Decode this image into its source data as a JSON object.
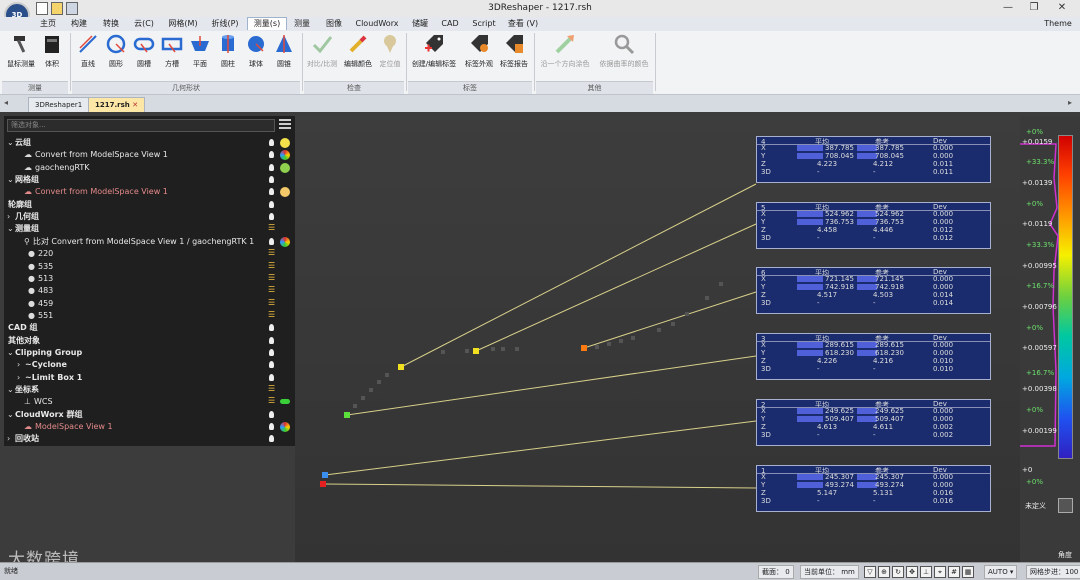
{
  "app": {
    "title": "3DReshaper - 1217.rsh",
    "icon_text": "3D"
  },
  "menu": [
    "主页",
    "构建",
    "转换",
    "云(C)",
    "网格(M)",
    "折线(P)",
    "测量(s)",
    "测量",
    "图像",
    "CloudWorx",
    "储罐",
    "CAD",
    "Script",
    "查看 (V)"
  ],
  "menu_active": "测量(s)",
  "theme_label": "Theme",
  "ribbon": {
    "buttons": [
      {
        "label": "鼠标测量",
        "icon": "hammer-icon"
      },
      {
        "label": "体积",
        "icon": "bucket-icon"
      },
      {
        "label": "直线",
        "icon": "line-icon"
      },
      {
        "label": "圆形",
        "icon": "circle-icon"
      },
      {
        "label": "圆槽",
        "icon": "slot-icon"
      },
      {
        "label": "方槽",
        "icon": "rect-slot-icon"
      },
      {
        "label": "平面",
        "icon": "plane-icon"
      },
      {
        "label": "圆柱",
        "icon": "cylinder-icon"
      },
      {
        "label": "球体",
        "icon": "sphere-icon"
      },
      {
        "label": "圆锥",
        "icon": "cone-icon"
      },
      {
        "label": "对比/比测",
        "icon": "check-icon"
      },
      {
        "label": "编辑颜色",
        "icon": "color-pencil-icon"
      },
      {
        "label": "定位值",
        "icon": "pin-icon"
      },
      {
        "label": "创建/编辑标签",
        "icon": "tag-icon"
      },
      {
        "label": "标签外观",
        "icon": "tag-style-icon"
      },
      {
        "label": "标签报告",
        "icon": "tag-report-icon"
      },
      {
        "label": "沿一个方向涂色",
        "icon": "direction-color-icon"
      },
      {
        "label": "依据曲率的颜色",
        "icon": "magnifier-icon"
      }
    ],
    "groups": [
      "测量",
      "几何形状",
      "检查",
      "标签",
      "其他"
    ]
  },
  "tabs": [
    "3DReshaper1",
    "1217.rsh"
  ],
  "tree": {
    "filter_placeholder": "筛选对象...",
    "items": [
      "云组",
      "Convert from ModelSpace  View 1",
      "gaochengRTK",
      "网格组",
      "Convert from ModelSpace  View 1",
      "轮廓组",
      "几何组",
      "测量组",
      "比对 Convert from ModelSpace  View 1 / gaochengRTK 1",
      "220",
      "535",
      "513",
      "483",
      "459",
      "551",
      "CAD 组",
      "其他对象",
      "Clipping Group",
      "~Cyclone",
      "~Limit Box 1",
      "坐标系",
      "WCS",
      "CloudWorx 群组",
      "ModelSpace  View 1",
      "回收站"
    ]
  },
  "cards": [
    {
      "id": "4",
      "hdr": [
        "平均",
        "参考",
        "Dev"
      ],
      "rows": [
        [
          "X",
          "387.785",
          "387.785",
          "0.000"
        ],
        [
          "Y",
          "708.045",
          "708.045",
          "0.000"
        ],
        [
          "Z",
          "4.223",
          "4.212",
          "0.011"
        ],
        [
          "3D",
          "-",
          "-",
          "0.011"
        ]
      ]
    },
    {
      "id": "5",
      "hdr": [
        "平均",
        "参考",
        "Dev"
      ],
      "rows": [
        [
          "X",
          "524.962",
          "524.962",
          "0.000"
        ],
        [
          "Y",
          "736.753",
          "736.753",
          "0.000"
        ],
        [
          "Z",
          "4.458",
          "4.446",
          "0.012"
        ],
        [
          "3D",
          "-",
          "-",
          "0.012"
        ]
      ]
    },
    {
      "id": "6",
      "hdr": [
        "平均",
        "参考",
        "Dev"
      ],
      "rows": [
        [
          "X",
          "721.145",
          "721.145",
          "0.000"
        ],
        [
          "Y",
          "742.918",
          "742.918",
          "0.000"
        ],
        [
          "Z",
          "4.517",
          "4.503",
          "0.014"
        ],
        [
          "3D",
          "-",
          "-",
          "0.014"
        ]
      ]
    },
    {
      "id": "3",
      "hdr": [
        "平均",
        "参考",
        "Dev"
      ],
      "rows": [
        [
          "X",
          "289.615",
          "289.615",
          "0.000"
        ],
        [
          "Y",
          "618.230",
          "618.230",
          "0.000"
        ],
        [
          "Z",
          "4.226",
          "4.216",
          "0.010"
        ],
        [
          "3D",
          "-",
          "-",
          "0.010"
        ]
      ]
    },
    {
      "id": "2",
      "hdr": [
        "平均",
        "参考",
        "Dev"
      ],
      "rows": [
        [
          "X",
          "249.625",
          "249.625",
          "0.000"
        ],
        [
          "Y",
          "509.407",
          "509.407",
          "0.000"
        ],
        [
          "Z",
          "4.613",
          "4.611",
          "0.002"
        ],
        [
          "3D",
          "-",
          "-",
          "0.002"
        ]
      ]
    },
    {
      "id": "1",
      "hdr": [
        "平均",
        "参考",
        "Dev"
      ],
      "rows": [
        [
          "X",
          "245.307",
          "245.307",
          "0.000"
        ],
        [
          "Y",
          "493.274",
          "493.274",
          "0.000"
        ],
        [
          "Z",
          "5.147",
          "5.131",
          "0.016"
        ],
        [
          "3D",
          "-",
          "-",
          "0.016"
        ]
      ]
    }
  ],
  "legend": {
    "values": [
      "+0.0159",
      "+0.0139",
      "+0.0119",
      "+0.00995",
      "+0.00796",
      "+0.00597",
      "+0.00398",
      "+0.00199",
      "+0"
    ],
    "percents": [
      "+0%",
      "+33.3%",
      "+0%",
      "+33.3%",
      "+16.7%",
      "+0%",
      "+16.7%",
      "+0%",
      "+0%"
    ],
    "undefined_label": "未定义",
    "angle_label": "角度"
  },
  "status": {
    "section_label": "截面：",
    "section_value": "0",
    "unit_label": "当前单位：",
    "unit_value": "mm",
    "auto_label": "AUTO",
    "step_label": "网格步进：",
    "step_value": "100",
    "left_label": "就绪"
  },
  "watermark": "大数跨境"
}
